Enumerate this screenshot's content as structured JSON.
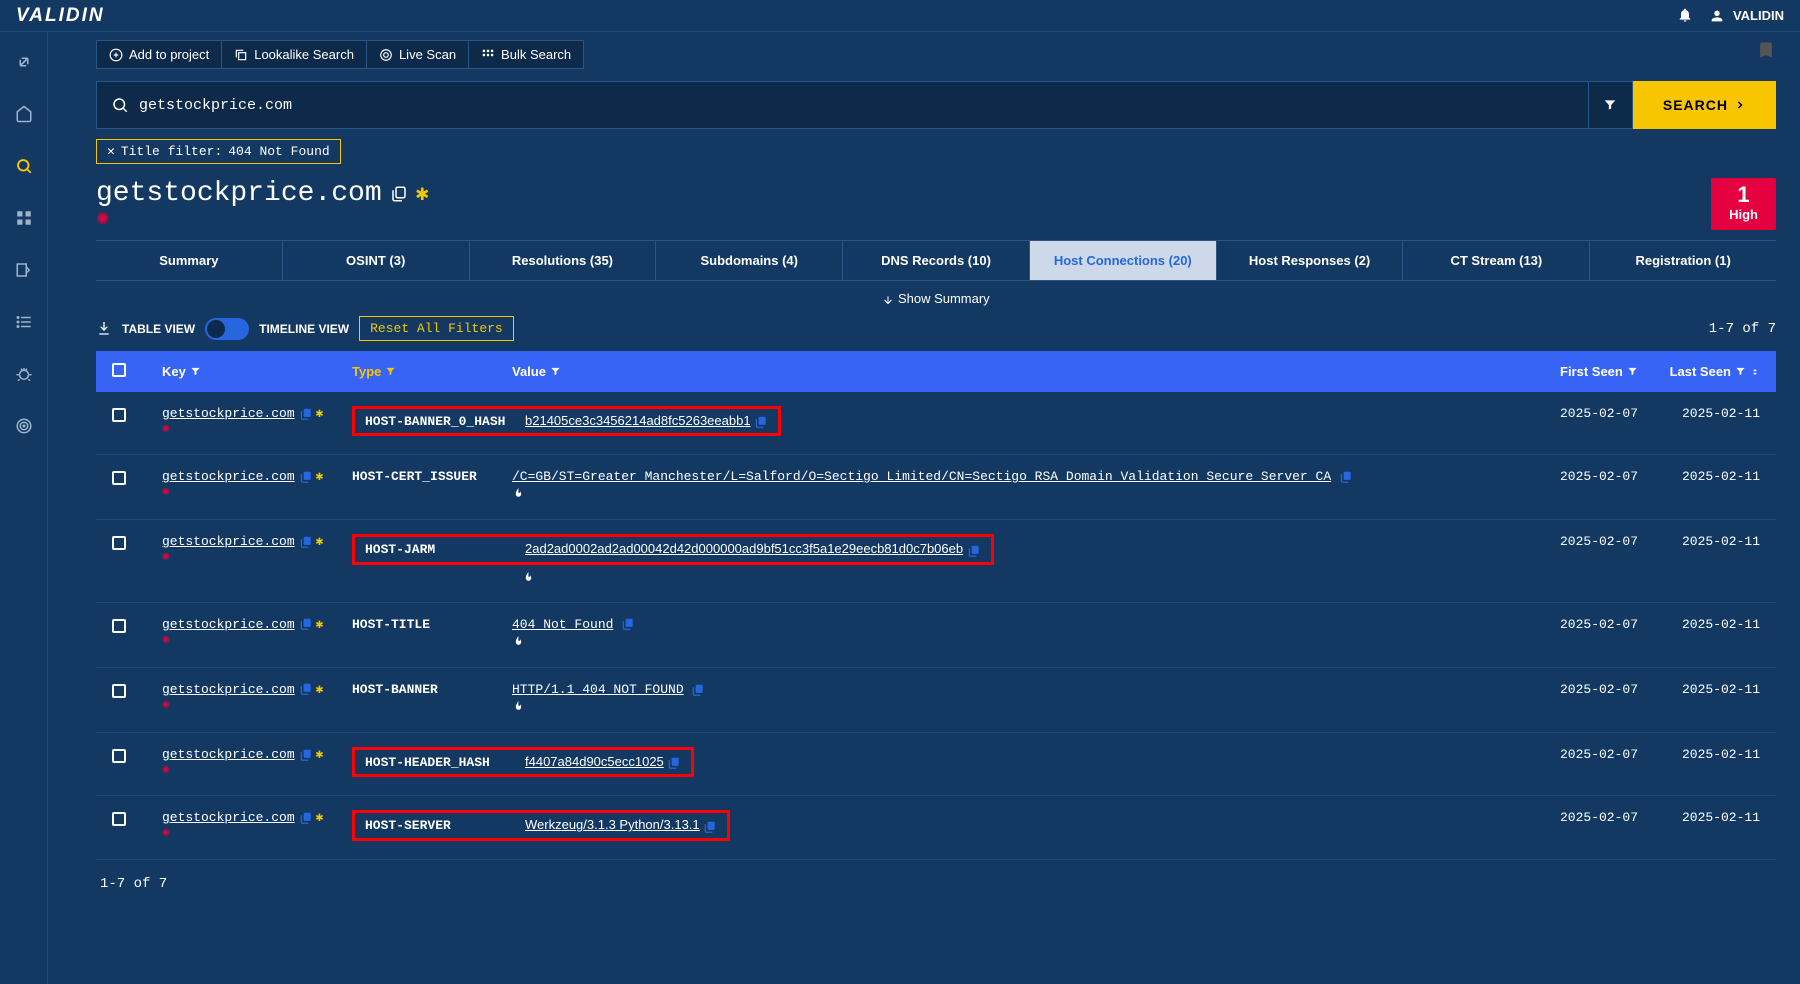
{
  "header": {
    "logo": "VALIDIN",
    "username": "VALIDIN"
  },
  "toolbar": {
    "add_to_project": "Add to project",
    "lookalike_search": "Lookalike Search",
    "live_scan": "Live Scan",
    "bulk_search": "Bulk Search"
  },
  "search": {
    "value": "getstockprice.com",
    "button": "SEARCH"
  },
  "filter_chip": {
    "label": "Title filter:",
    "value": "404 Not Found"
  },
  "domain_title": "getstockprice.com",
  "severity": {
    "count": "1",
    "label": "High"
  },
  "tabs": [
    {
      "label": "Summary"
    },
    {
      "label": "OSINT (3)"
    },
    {
      "label": "Resolutions (35)"
    },
    {
      "label": "Subdomains (4)"
    },
    {
      "label": "DNS Records (10)"
    },
    {
      "label": "Host Connections (20)",
      "active": true
    },
    {
      "label": "Host Responses (2)"
    },
    {
      "label": "CT Stream (13)"
    },
    {
      "label": "Registration (1)"
    }
  ],
  "show_summary": "Show Summary",
  "view": {
    "table": "TABLE VIEW",
    "timeline": "TIMELINE VIEW",
    "reset": "Reset All Filters"
  },
  "pagination": "1-7 of 7",
  "columns": {
    "key": "Key",
    "type": "Type",
    "value": "Value",
    "first_seen": "First Seen",
    "last_seen": "Last Seen"
  },
  "rows": [
    {
      "key": "getstockprice.com",
      "type": "HOST-BANNER_0_HASH",
      "value": "b21405ce3c3456214ad8fc5263eeabb1",
      "first_seen": "2025-02-07",
      "last_seen": "2025-02-11",
      "highlight": "both",
      "fire": false
    },
    {
      "key": "getstockprice.com",
      "type": "HOST-CERT_ISSUER",
      "value": "/C=GB/ST=Greater Manchester/L=Salford/O=Sectigo Limited/CN=Sectigo RSA Domain Validation Secure Server CA",
      "first_seen": "2025-02-07",
      "last_seen": "2025-02-11",
      "highlight": "none",
      "fire": true
    },
    {
      "key": "getstockprice.com",
      "type": "HOST-JARM",
      "value": "2ad2ad0002ad2ad00042d42d000000ad9bf51cc3f5a1e29eecb81d0c7b06eb",
      "first_seen": "2025-02-07",
      "last_seen": "2025-02-11",
      "highlight": "both",
      "fire": true
    },
    {
      "key": "getstockprice.com",
      "type": "HOST-TITLE",
      "value": "404 Not Found",
      "first_seen": "2025-02-07",
      "last_seen": "2025-02-11",
      "highlight": "none",
      "fire": true
    },
    {
      "key": "getstockprice.com",
      "type": "HOST-BANNER",
      "value": "HTTP/1.1 404 NOT FOUND",
      "first_seen": "2025-02-07",
      "last_seen": "2025-02-11",
      "highlight": "none",
      "fire": true
    },
    {
      "key": "getstockprice.com",
      "type": "HOST-HEADER_HASH",
      "value": "f4407a84d90c5ecc1025",
      "first_seen": "2025-02-07",
      "last_seen": "2025-02-11",
      "highlight": "both",
      "fire": false
    },
    {
      "key": "getstockprice.com",
      "type": "HOST-SERVER",
      "value": "Werkzeug/3.1.3 Python/3.13.1",
      "first_seen": "2025-02-07",
      "last_seen": "2025-02-11",
      "highlight": "both",
      "fire": false
    }
  ]
}
